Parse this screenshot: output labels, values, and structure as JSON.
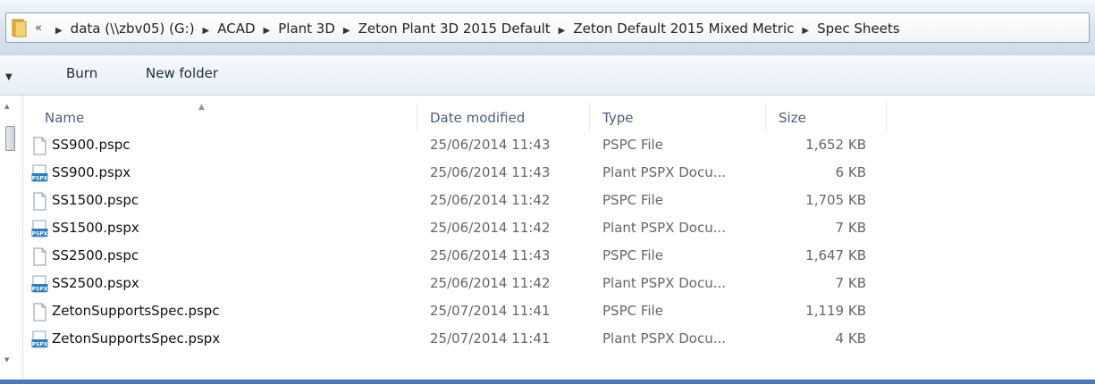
{
  "address": {
    "prefix": "«",
    "crumbs": [
      "data (\\\\zbv05) (G:)",
      "ACAD",
      "Plant 3D",
      "Zeton Plant 3D 2015 Default",
      "Zeton Default 2015 Mixed Metric",
      "Spec Sheets"
    ]
  },
  "toolbar": {
    "burn_label": "Burn",
    "new_folder_label": "New folder"
  },
  "columns": {
    "name": "Name",
    "date": "Date modified",
    "type": "Type",
    "size": "Size"
  },
  "icons": {
    "pspc": "blank-document-icon",
    "pspx": "pspx-document-icon",
    "pspx_badge": "PSPX",
    "folder": "folder-icon"
  },
  "colors": {
    "pspx_blue": "#2a7dc4",
    "header_text": "#4c607a",
    "accent_bar": "#4b79b7"
  },
  "files": [
    {
      "name": "SS900.pspc",
      "date": "25/06/2014 11:43",
      "type": "PSPC File",
      "size": "1,652 KB",
      "kind": "pspc"
    },
    {
      "name": "SS900.pspx",
      "date": "25/06/2014 11:43",
      "type": "Plant PSPX Docu...",
      "size": "6 KB",
      "kind": "pspx"
    },
    {
      "name": "SS1500.pspc",
      "date": "25/06/2014 11:42",
      "type": "PSPC File",
      "size": "1,705 KB",
      "kind": "pspc"
    },
    {
      "name": "SS1500.pspx",
      "date": "25/06/2014 11:42",
      "type": "Plant PSPX Docu...",
      "size": "7 KB",
      "kind": "pspx"
    },
    {
      "name": "SS2500.pspc",
      "date": "25/06/2014 11:43",
      "type": "PSPC File",
      "size": "1,647 KB",
      "kind": "pspc"
    },
    {
      "name": "SS2500.pspx",
      "date": "25/06/2014 11:42",
      "type": "Plant PSPX Docu...",
      "size": "7 KB",
      "kind": "pspx"
    },
    {
      "name": "ZetonSupportsSpec.pspc",
      "date": "25/07/2014 11:41",
      "type": "PSPC File",
      "size": "1,119 KB",
      "kind": "pspc"
    },
    {
      "name": "ZetonSupportsSpec.pspx",
      "date": "25/07/2014 11:41",
      "type": "Plant PSPX Docu...",
      "size": "4 KB",
      "kind": "pspx"
    }
  ]
}
